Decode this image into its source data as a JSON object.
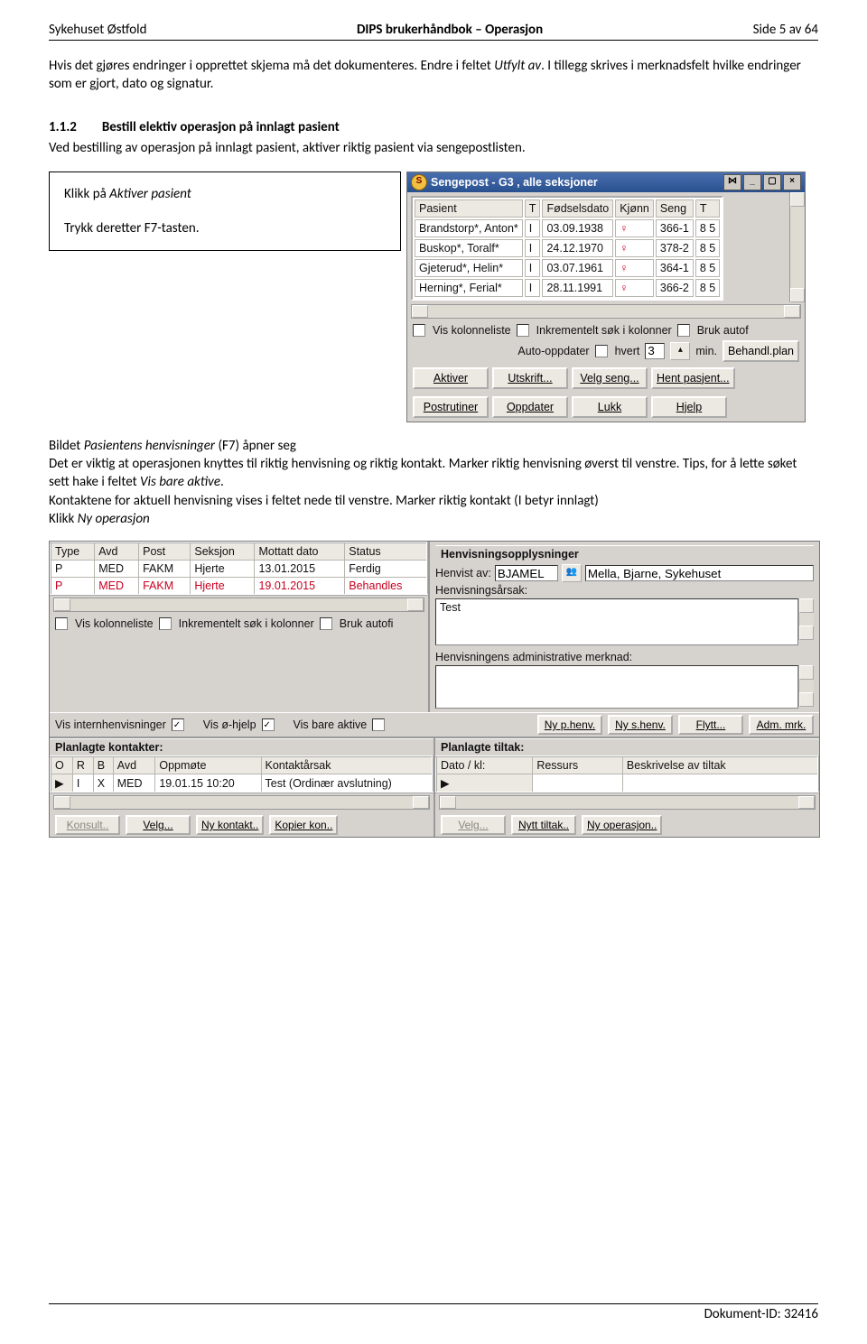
{
  "header": {
    "left": "Sykehuset Østfold",
    "center": "DIPS brukerhåndbok – Operasjon",
    "right": "Side 5 av 64"
  },
  "intro": {
    "p1a": "Hvis det gjøres endringer i opprettet skjema må det dokumenteres. Endre i feltet ",
    "p1i": "Utfylt av",
    "p1b": ". I tillegg skrives i merknadsfelt hvilke endringer som er gjort, dato og signatur."
  },
  "sec": {
    "num": "1.1.2",
    "title": "Bestill elektiv operasjon på innlagt pasient",
    "lead": "Ved bestilling av operasjon på innlagt pasient, aktiver riktig pasient via sengepostlisten."
  },
  "box": {
    "l1a": "Klikk på ",
    "l1i": "Aktiver pasient",
    "l2": "Trykk deretter F7-tasten."
  },
  "win1": {
    "title": "Sengepost - G3 , alle seksjoner",
    "headers": [
      "Pasient",
      "T",
      "Fødselsdato",
      "Kjønn",
      "Seng",
      "T"
    ],
    "rows": [
      {
        "p": "Brandstorp*, Anton*",
        "t": "I",
        "dob": "03.09.1938",
        "k": "♀",
        "s": "366-1",
        "n": "8\n5"
      },
      {
        "p": "Buskop*, Toralf*",
        "t": "I",
        "dob": "24.12.1970",
        "k": "♀",
        "s": "378-2",
        "n": "8\n5"
      },
      {
        "p": "Gjeterud*, Helin*",
        "t": "I",
        "dob": "03.07.1961",
        "k": "♀",
        "s": "364-1",
        "n": "8\n5"
      },
      {
        "p": "Herning*, Ferial*",
        "t": "I",
        "dob": "28.11.1991",
        "k": "♀",
        "s": "366-2",
        "n": "8\n5"
      }
    ],
    "chk1": "Vis kolonneliste",
    "chk2": "Inkrementelt søk i kolonner",
    "chk3": "Bruk autof",
    "auto_l": "Auto-oppdater",
    "hvert": "hvert",
    "autoval": "3",
    "min": "min.",
    "behandl": "Behandl.plan",
    "b": [
      "Aktiver",
      "Utskrift...",
      "Velg seng...",
      "Hent pasjent..."
    ],
    "b2": [
      "Postrutiner",
      "Oppdater",
      "Lukk",
      "Hjelp"
    ]
  },
  "mid": {
    "p1a": "Bildet ",
    "p1i": "Pasientens henvisninger",
    "p1b": " (F7) åpner seg",
    "p2": "Det er viktig at operasjonen knyttes til riktig henvisning og riktig kontakt. Marker riktig henvisning øverst til venstre. Tips, for å lette søket sett hake i feltet ",
    "p2i": "Vis bare aktive",
    "p2b": ".",
    "p3": "Kontaktene for aktuell henvisning vises i feltet nede til venstre. Marker riktig kontakt (I betyr innlagt)",
    "p4a": "Klikk ",
    "p4i": "Ny operasjon"
  },
  "win2": {
    "headers1": [
      "Type",
      "Avd",
      "Post",
      "Seksjon",
      "Mottatt dato",
      "Status"
    ],
    "rows1": [
      {
        "c": [
          "P",
          "MED",
          "FAKM",
          "Hjerte",
          "13.01.2015",
          "Ferdig"
        ],
        "r": false
      },
      {
        "c": [
          "P",
          "MED",
          "FAKM",
          "Hjerte",
          "19.01.2015",
          "Behandles"
        ],
        "r": true
      }
    ],
    "chk": [
      "Vis kolonneliste",
      "Inkrementelt søk i kolonner",
      "Bruk autofi"
    ],
    "opts": {
      "intern": "Vis internhenvisninger",
      "ohjelp": "Vis ø-hjelp",
      "aktive": "Vis bare aktive"
    },
    "optbtn": [
      "Ny p.henv.",
      "Ny s.henv.",
      "Flytt...",
      "Adm. mrk."
    ],
    "pk_label": "Planlagte kontakter:",
    "pk_h": [
      "O",
      "R",
      "B",
      "Avd",
      "Oppmøte",
      "Kontaktårsak"
    ],
    "pk_r": [
      "I",
      "X",
      "",
      "MED",
      "19.01.15 10:20",
      "Test (Ordinær avslutning)"
    ],
    "pk_btn": [
      "Konsult..",
      "Velg...",
      "Ny kontakt..",
      "Kopier kon.."
    ],
    "pt_label": "Planlagte tiltak:",
    "pt_h": [
      "Dato / kl:",
      "Ressurs",
      "Beskrivelse av tiltak"
    ],
    "pt_btn": [
      "Velg...",
      "Nytt tiltak..",
      "Ny operasjon.."
    ],
    "rgrp": "Henvisningsopplysninger",
    "rhv": "Henvist av:",
    "rhv_code": "BJAMEL",
    "rhv_name": "Mella, Bjarne, Sykehuset",
    "raar": "Henvisningsårsak:",
    "raar_v": "Test",
    "rmerk": "Henvisningens administrative merknad:"
  },
  "footer": {
    "id": "Dokument-ID: 32416"
  }
}
